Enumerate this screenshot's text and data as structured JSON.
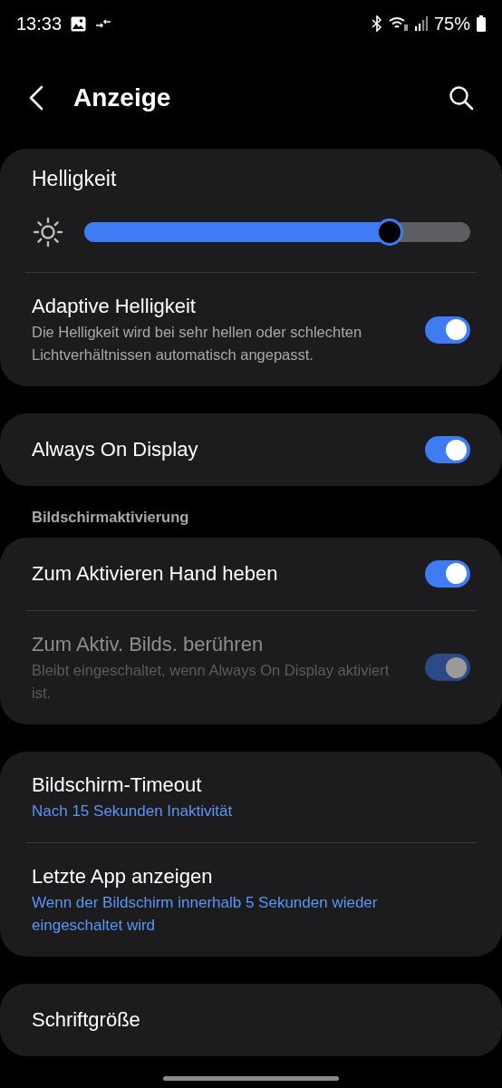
{
  "status_bar": {
    "time": "13:33",
    "battery": "75%"
  },
  "header": {
    "title": "Anzeige"
  },
  "groups": [
    {
      "rows": [
        {
          "kind": "slider",
          "title": "Helligkeit",
          "level": 0.79
        },
        {
          "kind": "toggle",
          "title": "Adaptive Helligkeit",
          "subtitle": "Die Helligkeit wird bei sehr hellen oder schlechten Lichtverhältnissen automatisch angepasst.",
          "on": true,
          "disabled": false
        }
      ]
    },
    {
      "rows": [
        {
          "kind": "toggle",
          "title": "Always On Display",
          "on": true,
          "disabled": false
        }
      ]
    },
    {
      "header": "Bildschirmaktivierung",
      "rows": [
        {
          "kind": "toggle",
          "title": "Zum Aktivieren Hand heben",
          "on": true,
          "disabled": false
        },
        {
          "kind": "toggle",
          "title": "Zum Aktiv. Bilds. berühren",
          "subtitle": "Bleibt eingeschaltet, wenn Always On Display aktiviert ist.",
          "on": true,
          "disabled": true
        }
      ]
    },
    {
      "rows": [
        {
          "kind": "link",
          "title": "Bildschirm-Timeout",
          "subtitle": "Nach 15 Sekunden Inaktivität"
        },
        {
          "kind": "link",
          "title": "Letzte App anzeigen",
          "subtitle": "Wenn der Bildschirm innerhalb 5 Sekunden wieder eingeschaltet wird"
        }
      ]
    },
    {
      "rows": [
        {
          "kind": "link",
          "title": "Schriftgröße"
        }
      ]
    }
  ]
}
